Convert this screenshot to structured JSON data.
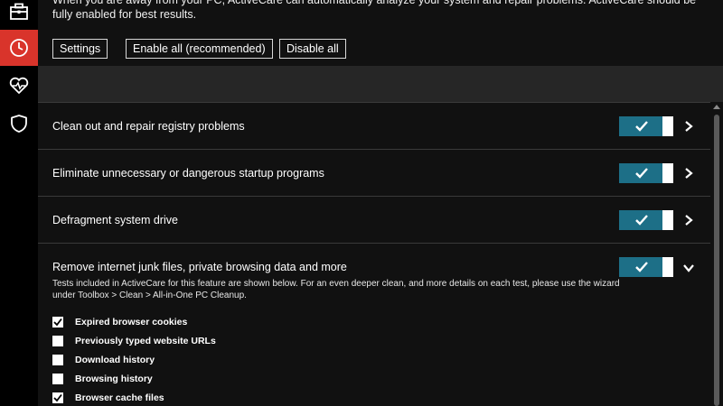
{
  "sidebar": {
    "items": [
      {
        "name": "toolbox",
        "icon": "toolbox-icon",
        "active": false
      },
      {
        "name": "clock",
        "icon": "clock-icon",
        "active": true
      },
      {
        "name": "health",
        "icon": "heartbeat-icon",
        "active": false
      },
      {
        "name": "protection",
        "icon": "shield-icon",
        "active": false
      }
    ],
    "active_color": "#d9342b"
  },
  "intro": {
    "text": "When you are away from your PC, ActiveCare can automatically analyze your system and repair problems. ActiveCare should be fully enabled for best results."
  },
  "buttons": {
    "settings": "Settings",
    "enable_all": "Enable all (recommended)",
    "disable_all": "Disable all"
  },
  "features": [
    {
      "label": "Clean out and repair registry problems",
      "enabled": true,
      "expanded": false
    },
    {
      "label": "Eliminate unnecessary or dangerous startup programs",
      "enabled": true,
      "expanded": false
    },
    {
      "label": "Defragment system drive",
      "enabled": true,
      "expanded": false
    },
    {
      "label": "Remove internet junk files, private browsing data and more",
      "enabled": true,
      "expanded": true
    }
  ],
  "expanded_detail": {
    "description": "Tests included in ActiveCare for this feature are shown below. For an even deeper clean, and more details on each test, please use the wizard under Toolbox > Clean > All-in-One PC Cleanup.",
    "checks": [
      {
        "label": "Expired browser cookies",
        "checked": true
      },
      {
        "label": "Previously typed website URLs",
        "checked": false
      },
      {
        "label": "Download history",
        "checked": false
      },
      {
        "label": "Browsing history",
        "checked": false
      },
      {
        "label": "Browser cache files",
        "checked": true
      }
    ]
  },
  "colors": {
    "toggle_on": "#1d6f87",
    "background": "#111111"
  }
}
